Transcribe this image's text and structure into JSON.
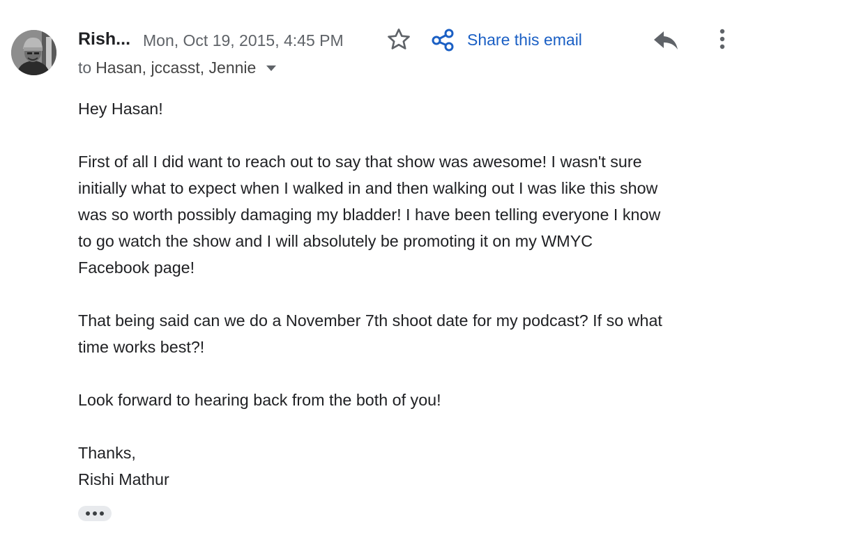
{
  "header": {
    "sender_name": "Rish...",
    "date": "Mon, Oct 19, 2015, 4:45 PM",
    "share_label": "Share this email",
    "to_label": "to",
    "recipients": "Hasan, jccasst, Jennie"
  },
  "icons": {
    "star": "star-outline-icon",
    "share": "share-icon",
    "reply": "reply-icon",
    "more": "more-vert-icon",
    "caret": "caret-down-icon",
    "trimmed": "more-horiz-icon"
  },
  "colors": {
    "accent": "#1a5fc4",
    "meta_text": "#5f6368",
    "body_text": "#202124",
    "chip_bg": "#e8eaed"
  },
  "body": {
    "greeting": "Hey Hasan!",
    "paragraph1_lines": [
      "First of all I did want to reach out to say that show was awesome! I wasn't sure",
      "initially what to expect when I walked in and then walking out I was like this show",
      "was so worth possibly damaging my bladder! I have been telling everyone I know",
      "to go watch the show and I will absolutely be promoting it on my WMYC",
      "Facebook page!"
    ],
    "paragraph2_lines": [
      "That being said can we do a November 7th shoot date for my podcast? If so what",
      "time works best?!"
    ],
    "paragraph3": "Look forward to hearing back from the both of you!",
    "signoff": "Thanks,",
    "signature": "Rishi Mathur"
  }
}
